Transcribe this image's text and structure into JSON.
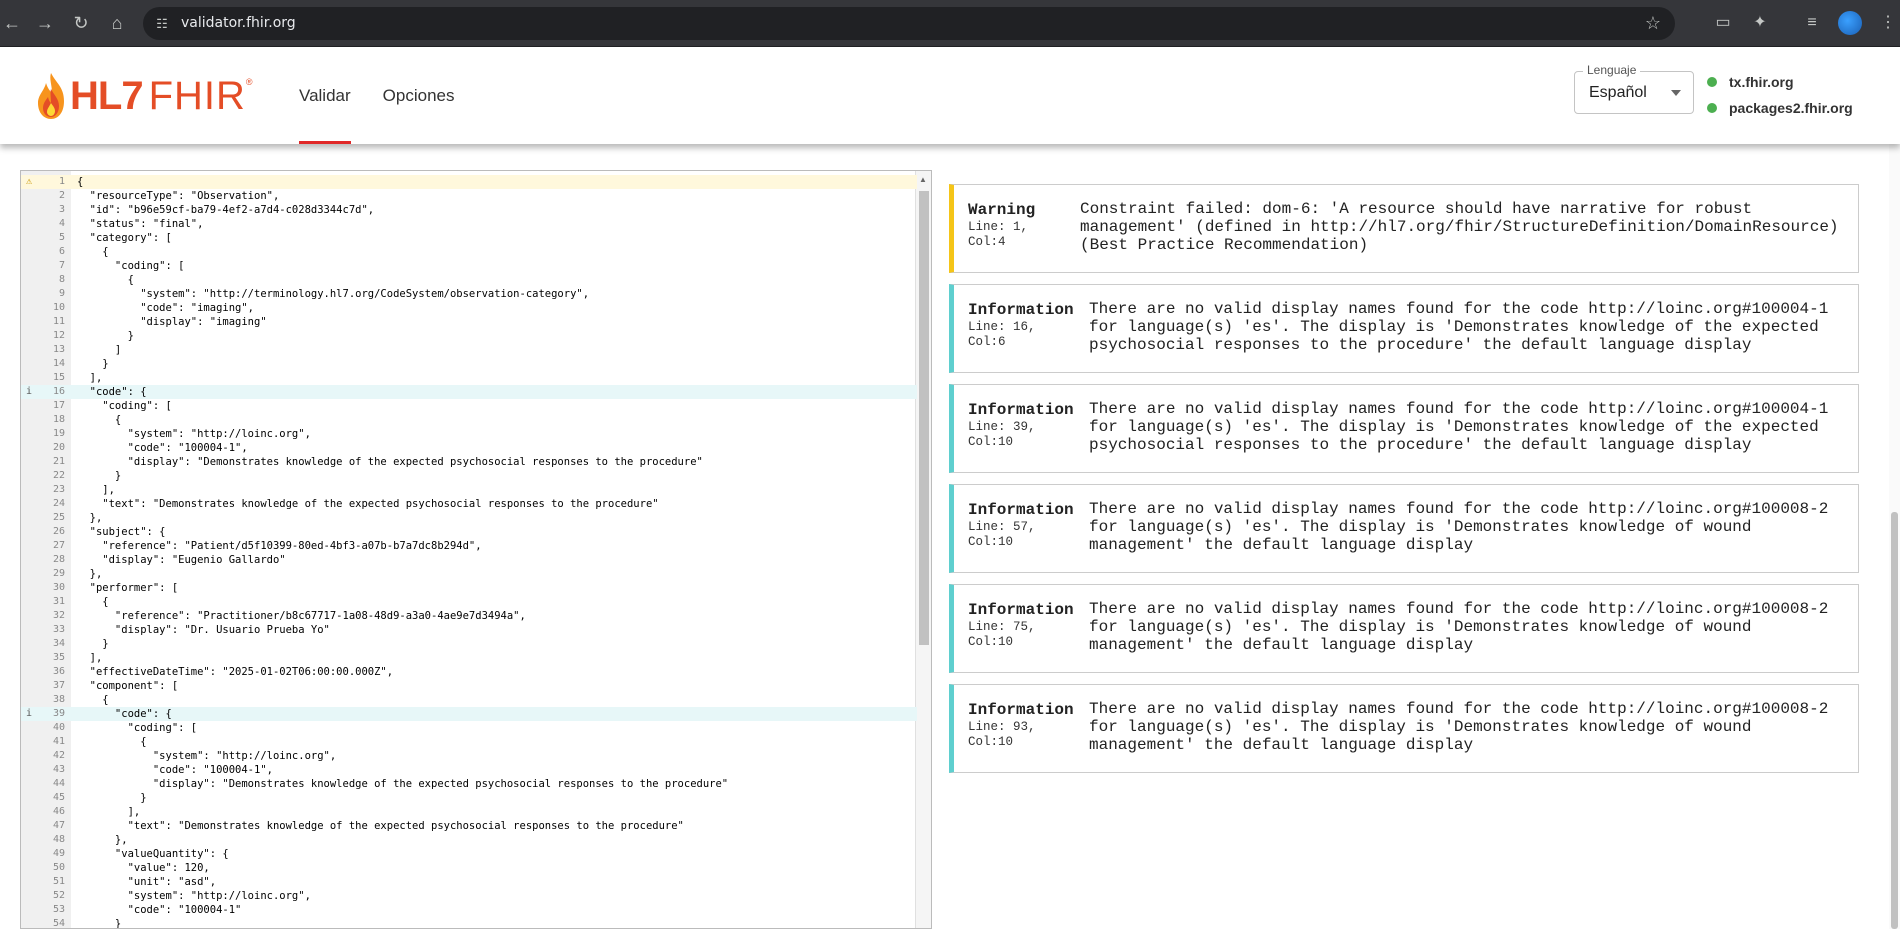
{
  "browser": {
    "url": "validator.fhir.org",
    "icons": [
      "back-icon",
      "forward-icon",
      "reload-icon",
      "home-icon",
      "site-info-icon",
      "star-icon",
      "cast-icon",
      "extensions-icon",
      "reading-list-icon",
      "profile-icon",
      "menu-icon"
    ]
  },
  "header": {
    "logo_hl7": "HL7",
    "logo_fhir": "FHIR",
    "logo_reg": "®",
    "tabs": [
      {
        "label": "Validar",
        "active": true
      },
      {
        "label": "Opciones",
        "active": false
      }
    ],
    "language": {
      "legend": "Lenguaje",
      "value": "Español"
    },
    "servers": [
      {
        "label": "tx.fhir.org",
        "status_color": "#4caf50"
      },
      {
        "label": "packages2.fhir.org",
        "status_color": "#4caf50"
      }
    ]
  },
  "editor": {
    "lines": [
      {
        "n": "1",
        "t": "{",
        "mark": "warn"
      },
      {
        "n": "2",
        "t": "  \"resourceType\": \"Observation\","
      },
      {
        "n": "3",
        "t": "  \"id\": \"b96e59cf-ba79-4ef2-a7d4-c028d3344c7d\","
      },
      {
        "n": "4",
        "t": "  \"status\": \"final\","
      },
      {
        "n": "5",
        "t": "  \"category\": ["
      },
      {
        "n": "6",
        "t": "    {"
      },
      {
        "n": "7",
        "t": "      \"coding\": ["
      },
      {
        "n": "8",
        "t": "        {"
      },
      {
        "n": "9",
        "t": "          \"system\": \"http://terminology.hl7.org/CodeSystem/observation-category\","
      },
      {
        "n": "10",
        "t": "          \"code\": \"imaging\","
      },
      {
        "n": "11",
        "t": "          \"display\": \"imaging\""
      },
      {
        "n": "12",
        "t": "        }"
      },
      {
        "n": "13",
        "t": "      ]"
      },
      {
        "n": "14",
        "t": "    }"
      },
      {
        "n": "15",
        "t": "  ],"
      },
      {
        "n": "16",
        "t": "  \"code\": {",
        "mark": "info"
      },
      {
        "n": "17",
        "t": "    \"coding\": ["
      },
      {
        "n": "18",
        "t": "      {"
      },
      {
        "n": "19",
        "t": "        \"system\": \"http://loinc.org\","
      },
      {
        "n": "20",
        "t": "        \"code\": \"100004-1\","
      },
      {
        "n": "21",
        "t": "        \"display\": \"Demonstrates knowledge of the expected psychosocial responses to the procedure\""
      },
      {
        "n": "22",
        "t": "      }"
      },
      {
        "n": "23",
        "t": "    ],"
      },
      {
        "n": "24",
        "t": "    \"text\": \"Demonstrates knowledge of the expected psychosocial responses to the procedure\""
      },
      {
        "n": "25",
        "t": "  },"
      },
      {
        "n": "26",
        "t": "  \"subject\": {"
      },
      {
        "n": "27",
        "t": "    \"reference\": \"Patient/d5f10399-80ed-4bf3-a07b-b7a7dc8b294d\","
      },
      {
        "n": "28",
        "t": "    \"display\": \"Eugenio Gallardo\""
      },
      {
        "n": "29",
        "t": "  },"
      },
      {
        "n": "30",
        "t": "  \"performer\": ["
      },
      {
        "n": "31",
        "t": "    {"
      },
      {
        "n": "32",
        "t": "      \"reference\": \"Practitioner/b8c67717-1a08-48d9-a3a0-4ae9e7d3494a\","
      },
      {
        "n": "33",
        "t": "      \"display\": \"Dr. Usuario Prueba Yo\""
      },
      {
        "n": "34",
        "t": "    }"
      },
      {
        "n": "35",
        "t": "  ],"
      },
      {
        "n": "36",
        "t": "  \"effectiveDateTime\": \"2025-01-02T06:00:00.000Z\","
      },
      {
        "n": "37",
        "t": "  \"component\": ["
      },
      {
        "n": "38",
        "t": "    {"
      },
      {
        "n": "39",
        "t": "      \"code\": {",
        "mark": "info"
      },
      {
        "n": "40",
        "t": "        \"coding\": ["
      },
      {
        "n": "41",
        "t": "          {"
      },
      {
        "n": "42",
        "t": "            \"system\": \"http://loinc.org\","
      },
      {
        "n": "43",
        "t": "            \"code\": \"100004-1\","
      },
      {
        "n": "44",
        "t": "            \"display\": \"Demonstrates knowledge of the expected psychosocial responses to the procedure\""
      },
      {
        "n": "45",
        "t": "          }"
      },
      {
        "n": "46",
        "t": "        ],"
      },
      {
        "n": "47",
        "t": "        \"text\": \"Demonstrates knowledge of the expected psychosocial responses to the procedure\""
      },
      {
        "n": "48",
        "t": "      },"
      },
      {
        "n": "49",
        "t": "      \"valueQuantity\": {"
      },
      {
        "n": "50",
        "t": "        \"value\": 120,"
      },
      {
        "n": "51",
        "t": "        \"unit\": \"asd\","
      },
      {
        "n": "52",
        "t": "        \"system\": \"http://loinc.org\","
      },
      {
        "n": "53",
        "t": "        \"code\": \"100004-1\""
      },
      {
        "n": "54",
        "t": "      }"
      }
    ]
  },
  "messages": [
    {
      "level": "Warning",
      "line": "Line: 1,",
      "col": "Col:4",
      "type": "warn",
      "text": "Constraint failed: dom-6: 'A resource should have narrative for robust\nmanagement' (defined in http://hl7.org/fhir/StructureDefinition/DomainResource)\n(Best Practice Recommendation)"
    },
    {
      "level": "Information",
      "line": "Line: 16,",
      "col": "Col:6",
      "type": "info",
      "text": "There are no valid display names found for the code http://loinc.org#100004-1\nfor language(s) 'es'. The display is 'Demonstrates knowledge of the expected\npsychosocial responses to the procedure' the default language display"
    },
    {
      "level": "Information",
      "line": "Line: 39,",
      "col": "Col:10",
      "type": "info",
      "text": "There are no valid display names found for the code http://loinc.org#100004-1\nfor language(s) 'es'. The display is 'Demonstrates knowledge of the expected\npsychosocial responses to the procedure' the default language display"
    },
    {
      "level": "Information",
      "line": "Line: 57,",
      "col": "Col:10",
      "type": "info",
      "text": "There are no valid display names found for the code http://loinc.org#100008-2\nfor language(s) 'es'. The display is 'Demonstrates knowledge of wound\nmanagement' the default language display"
    },
    {
      "level": "Information",
      "line": "Line: 75,",
      "col": "Col:10",
      "type": "info",
      "text": "There are no valid display names found for the code http://loinc.org#100008-2\nfor language(s) 'es'. The display is 'Demonstrates knowledge of wound\nmanagement' the default language display"
    },
    {
      "level": "Information",
      "line": "Line: 93,",
      "col": "Col:10",
      "type": "info",
      "text": "There are no valid display names found for the code http://loinc.org#100008-2\nfor language(s) 'es'. The display is 'Demonstrates knowledge of wound\nmanagement' the default language display"
    }
  ],
  "colors": {
    "warning_accent": "#f5c518",
    "info_accent": "#5fcfcf",
    "tab_underline": "#e02828",
    "brand": "#e44d26"
  }
}
